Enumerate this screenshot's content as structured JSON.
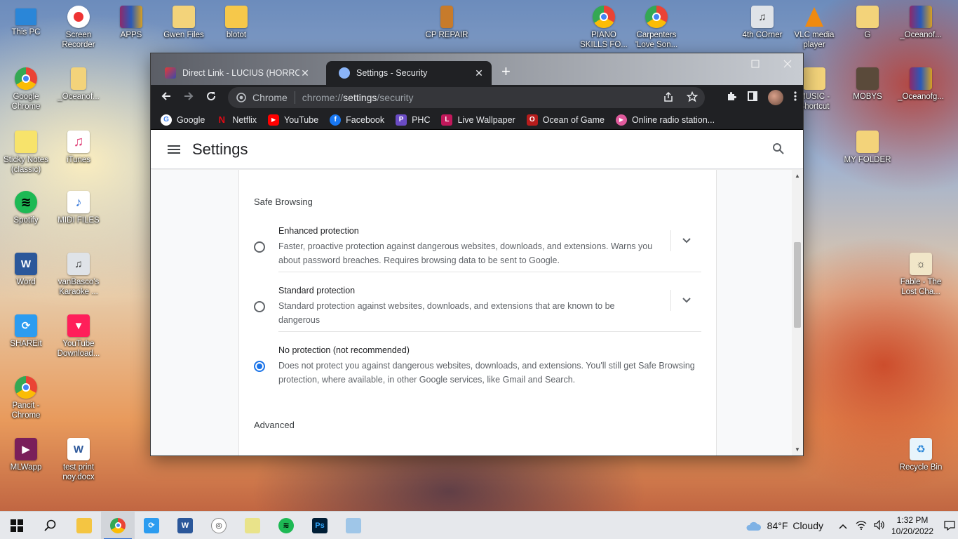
{
  "desktop": {
    "icons": [
      {
        "label": "This PC"
      },
      {
        "label": "Screen Recorder"
      },
      {
        "label": "APPS"
      },
      {
        "label": "Gwen Files"
      },
      {
        "label": "blotot"
      },
      {
        "label": "CP REPAIR"
      },
      {
        "label": "PIANO SKILLS FO..."
      },
      {
        "label": "Carpenters 'Love Son..."
      },
      {
        "label": "4th COrner"
      },
      {
        "label": "VLC media player"
      },
      {
        "label": "G"
      },
      {
        "label": "_Oceanof..."
      },
      {
        "label": "Google Chrome"
      },
      {
        "label": "_Oceanof..."
      },
      {
        "label": "MUSIC - Shortcut"
      },
      {
        "label": "MOBYS"
      },
      {
        "label": "_Oceanofg..."
      },
      {
        "label": "Sticky Notes (classic)"
      },
      {
        "label": "iTunes"
      },
      {
        "label": "MY FOLDER"
      },
      {
        "label": "Spotify"
      },
      {
        "label": "MIDI FILES"
      },
      {
        "label": "Word"
      },
      {
        "label": "vanBasco's Karaoke ..."
      },
      {
        "label": "Fable - The Lost Cha..."
      },
      {
        "label": "SHAREit"
      },
      {
        "label": "YouTube Download..."
      },
      {
        "label": "Pancit - Chrome"
      },
      {
        "label": "MLWapp"
      },
      {
        "label": "test print noy.docx"
      },
      {
        "label": "Recycle Bin"
      }
    ]
  },
  "browser": {
    "tabs": [
      {
        "title": "Direct Link - LUCIUS (HORROR P...",
        "close": "✕"
      },
      {
        "title": "Settings - Security",
        "close": "✕"
      }
    ],
    "new_tab": "+",
    "omnibox": {
      "chip": "Chrome",
      "url_scheme": "chrome://",
      "url_host": "settings",
      "url_path": "/security"
    },
    "bookmarks": [
      {
        "label": "Google",
        "color": "#4285f4",
        "glyph": "G"
      },
      {
        "label": "Netflix",
        "color": "#e50914",
        "glyph": "N"
      },
      {
        "label": "YouTube",
        "color": "#ff0000",
        "glyph": "▶"
      },
      {
        "label": "Facebook",
        "color": "#1877f2",
        "glyph": "f"
      },
      {
        "label": "PHC",
        "color": "#6a4bc4",
        "glyph": "P"
      },
      {
        "label": "Live Wallpaper",
        "color": "#c2185b",
        "glyph": "L"
      },
      {
        "label": "Ocean of Game",
        "color": "#b71c1c",
        "glyph": "O"
      },
      {
        "label": "Online radio station...",
        "color": "#e05a9c",
        "glyph": "▶"
      }
    ]
  },
  "settings": {
    "title": "Settings",
    "safe_browsing": {
      "heading": "Safe Browsing",
      "options": [
        {
          "title": "Enhanced protection",
          "desc": "Faster, proactive protection against dangerous websites, downloads, and extensions. Warns you about password breaches. Requires browsing data to be sent to Google.",
          "selected": false
        },
        {
          "title": "Standard protection",
          "desc": "Standard protection against websites, downloads, and extensions that are known to be dangerous",
          "selected": false
        },
        {
          "title": "No protection (not recommended)",
          "desc": "Does not protect you against dangerous websites, downloads, and extensions. You'll still get Safe Browsing protection, where available, in other Google services, like Gmail and Search.",
          "selected": true
        }
      ]
    },
    "advanced": {
      "heading": "Advanced"
    },
    "accent_color": "#1a73e8"
  },
  "taskbar": {
    "weather_temp": "84°F",
    "weather_desc": "Cloudy",
    "time": "1:32 PM",
    "date": "10/20/2022"
  }
}
